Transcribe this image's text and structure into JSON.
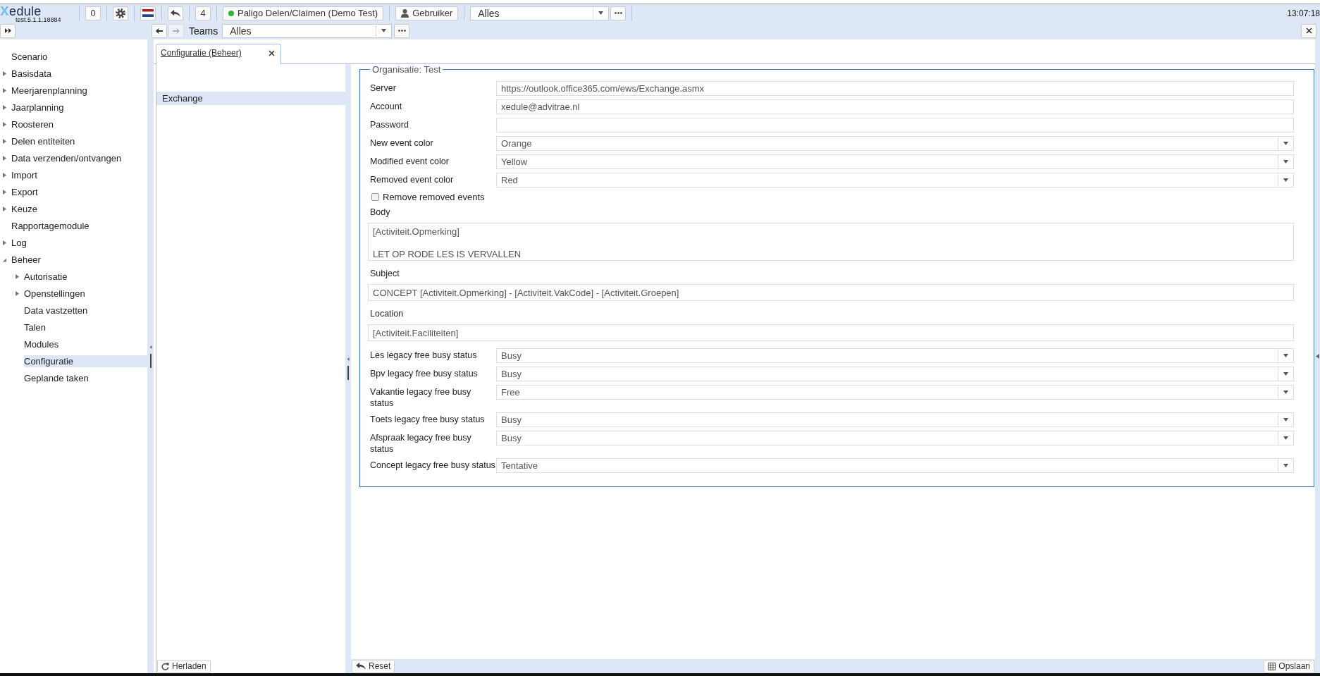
{
  "header": {
    "logo": "xedule",
    "version": "test.5.1.1.18884",
    "buttons": [
      {
        "kind": "text",
        "label": "0"
      },
      {
        "kind": "gear"
      },
      {
        "kind": "flag"
      },
      {
        "kind": "undo"
      },
      {
        "kind": "text",
        "label": "4"
      },
      {
        "kind": "status",
        "label": "Paligo Delen/Claimen (Demo Test)",
        "online": true
      },
      {
        "kind": "user",
        "label": "Gebruiker"
      }
    ],
    "scope_select": {
      "value": "Alles"
    },
    "time": "13:07:18"
  },
  "subbar": {
    "nav": [
      {
        "kind": "back",
        "disabled": false
      },
      {
        "kind": "forward",
        "disabled": true
      }
    ],
    "label": "Teams",
    "select": {
      "value": "Alles"
    }
  },
  "sidebar": {
    "items": [
      {
        "label": "Scenario",
        "selected": false
      },
      {
        "label": "Basisdata",
        "expanded": false,
        "selected": false
      },
      {
        "label": "Meerjarenplanning",
        "expanded": false,
        "selected": false
      },
      {
        "label": "Jaarplanning",
        "expanded": false,
        "selected": false
      },
      {
        "label": "Roosteren",
        "expanded": false,
        "selected": false
      },
      {
        "label": "Delen entiteiten",
        "expanded": false,
        "selected": false
      },
      {
        "label": "Data verzenden/ontvangen",
        "expanded": false,
        "selected": false
      },
      {
        "label": "Import",
        "expanded": false,
        "selected": false
      },
      {
        "label": "Export",
        "expanded": false,
        "selected": false
      },
      {
        "label": "Keuze",
        "expanded": false,
        "selected": false
      },
      {
        "label": "Rapportagemodule",
        "selected": false
      },
      {
        "label": "Log",
        "expanded": false,
        "selected": false
      },
      {
        "label": "Beheer",
        "expanded": true,
        "selected": false,
        "children": [
          {
            "label": "Autorisatie",
            "expanded": false,
            "selected": false
          },
          {
            "label": "Openstellingen",
            "expanded": false,
            "selected": false
          },
          {
            "label": "Data vastzetten",
            "selected": false
          },
          {
            "label": "Talen",
            "selected": false
          },
          {
            "label": "Modules",
            "selected": false
          },
          {
            "label": "Configuratie",
            "selected": true
          },
          {
            "label": "Geplande taken",
            "selected": false
          }
        ]
      }
    ]
  },
  "tabs": [
    {
      "label": "Configuratie (Beheer)",
      "selected": true
    }
  ],
  "config_list": {
    "items": [
      {
        "label": "Exchange",
        "selected": true
      }
    ],
    "reload_button": "Herladen"
  },
  "form": {
    "legend": "Organisatie: Test",
    "fields": [
      {
        "kind": "text",
        "label": "Server",
        "value": "https://outlook.office365.com/ews/Exchange.asmx"
      },
      {
        "kind": "text",
        "label": "Account",
        "value": "xedule@advitrae.nl"
      },
      {
        "kind": "password",
        "label": "Password"
      },
      {
        "kind": "select",
        "label": "New event color",
        "value": "Orange"
      },
      {
        "kind": "select",
        "label": "Modified event color",
        "value": "Yellow"
      },
      {
        "kind": "select",
        "label": "Removed event color",
        "value": "Red"
      },
      {
        "kind": "checkbox",
        "label": "Remove removed events",
        "checked": false
      },
      {
        "kind": "textarea",
        "label": "Body",
        "value": "[Activiteit.Opmerking]\n\nLET OP RODE LES IS VERVALLEN"
      },
      {
        "kind": "wide_text",
        "label": "Subject",
        "value": "CONCEPT [Activiteit.Opmerking] - [Activiteit.VakCode] - [Activiteit.Groepen]"
      },
      {
        "kind": "wide_text",
        "label": "Location",
        "value": "[Activiteit.Faciliteiten]"
      },
      {
        "kind": "select",
        "label": "Les legacy free busy status",
        "value": "Busy"
      },
      {
        "kind": "select",
        "label": "Bpv legacy free busy status",
        "value": "Busy"
      },
      {
        "kind": "select",
        "label": "Vakantie legacy free busy status",
        "value": "Free"
      },
      {
        "kind": "select",
        "label": "Toets legacy free busy status",
        "value": "Busy"
      },
      {
        "kind": "select",
        "label": "Afspraak legacy free busy status",
        "value": "Busy"
      },
      {
        "kind": "select",
        "label": "Concept legacy free busy status",
        "value": "Tentative"
      }
    ]
  },
  "footer": {
    "buttons": [
      {
        "kind": "reset",
        "label": "Reset"
      },
      {
        "kind": "save",
        "label": "Opslaan"
      }
    ]
  }
}
